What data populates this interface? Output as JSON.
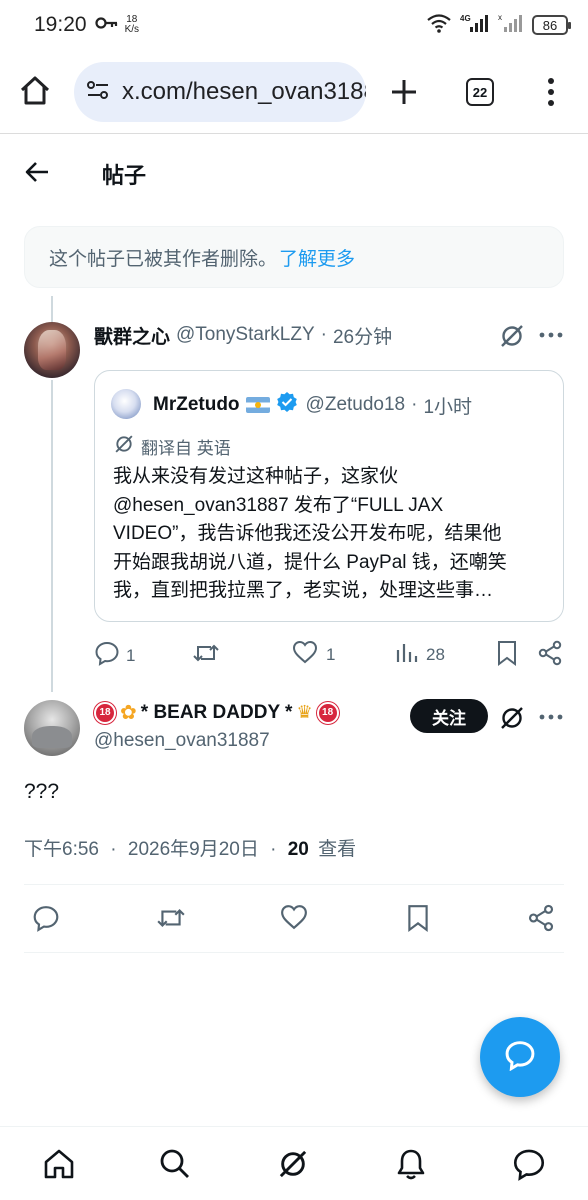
{
  "status_bar": {
    "time": "19:20",
    "net_speed_value": "18",
    "net_speed_unit": "K/s",
    "battery": "86"
  },
  "browser": {
    "url": "x.com/hesen_ovan31887",
    "tab_count": "22"
  },
  "header": {
    "title": "帖子"
  },
  "deleted_notice": {
    "text": "这个帖子已被其作者删除。",
    "link": "了解更多"
  },
  "reply_post": {
    "display_name": "獸群之心",
    "handle": "@TonyStarkLZY",
    "separator": "·",
    "time": "26分钟",
    "quote": {
      "display_name": "MrZetudo",
      "handle": "@Zetudo18",
      "separator": "·",
      "time": "1小时",
      "translate_label": "翻译自 英语",
      "body_lines": [
        "我从来没有发过这种帖子，这家伙",
        "@hesen_ovan31887 发布了“FULL JAX",
        "VIDEO”，我告诉他我还没公开发布呢，结果他",
        "开始跟我胡说八道，提什么 PayPal 钱，还嘲笑",
        "我，直到把我拉黑了，老实说，处理这些事…"
      ]
    },
    "actions": {
      "replies": "1",
      "reposts": "",
      "likes": "1",
      "views": "28"
    }
  },
  "main_post": {
    "display_name": "* BEAR DADDY *",
    "handle": "@hesen_ovan31887",
    "follow_label": "关注",
    "text": "???",
    "meta": {
      "time": "下午6:56",
      "separator": "·",
      "date": "2026年9月20日",
      "separator2": "·",
      "views_count": "20",
      "views_label": "查看"
    }
  },
  "icons": {
    "accent_color": "#1d9bf0"
  }
}
